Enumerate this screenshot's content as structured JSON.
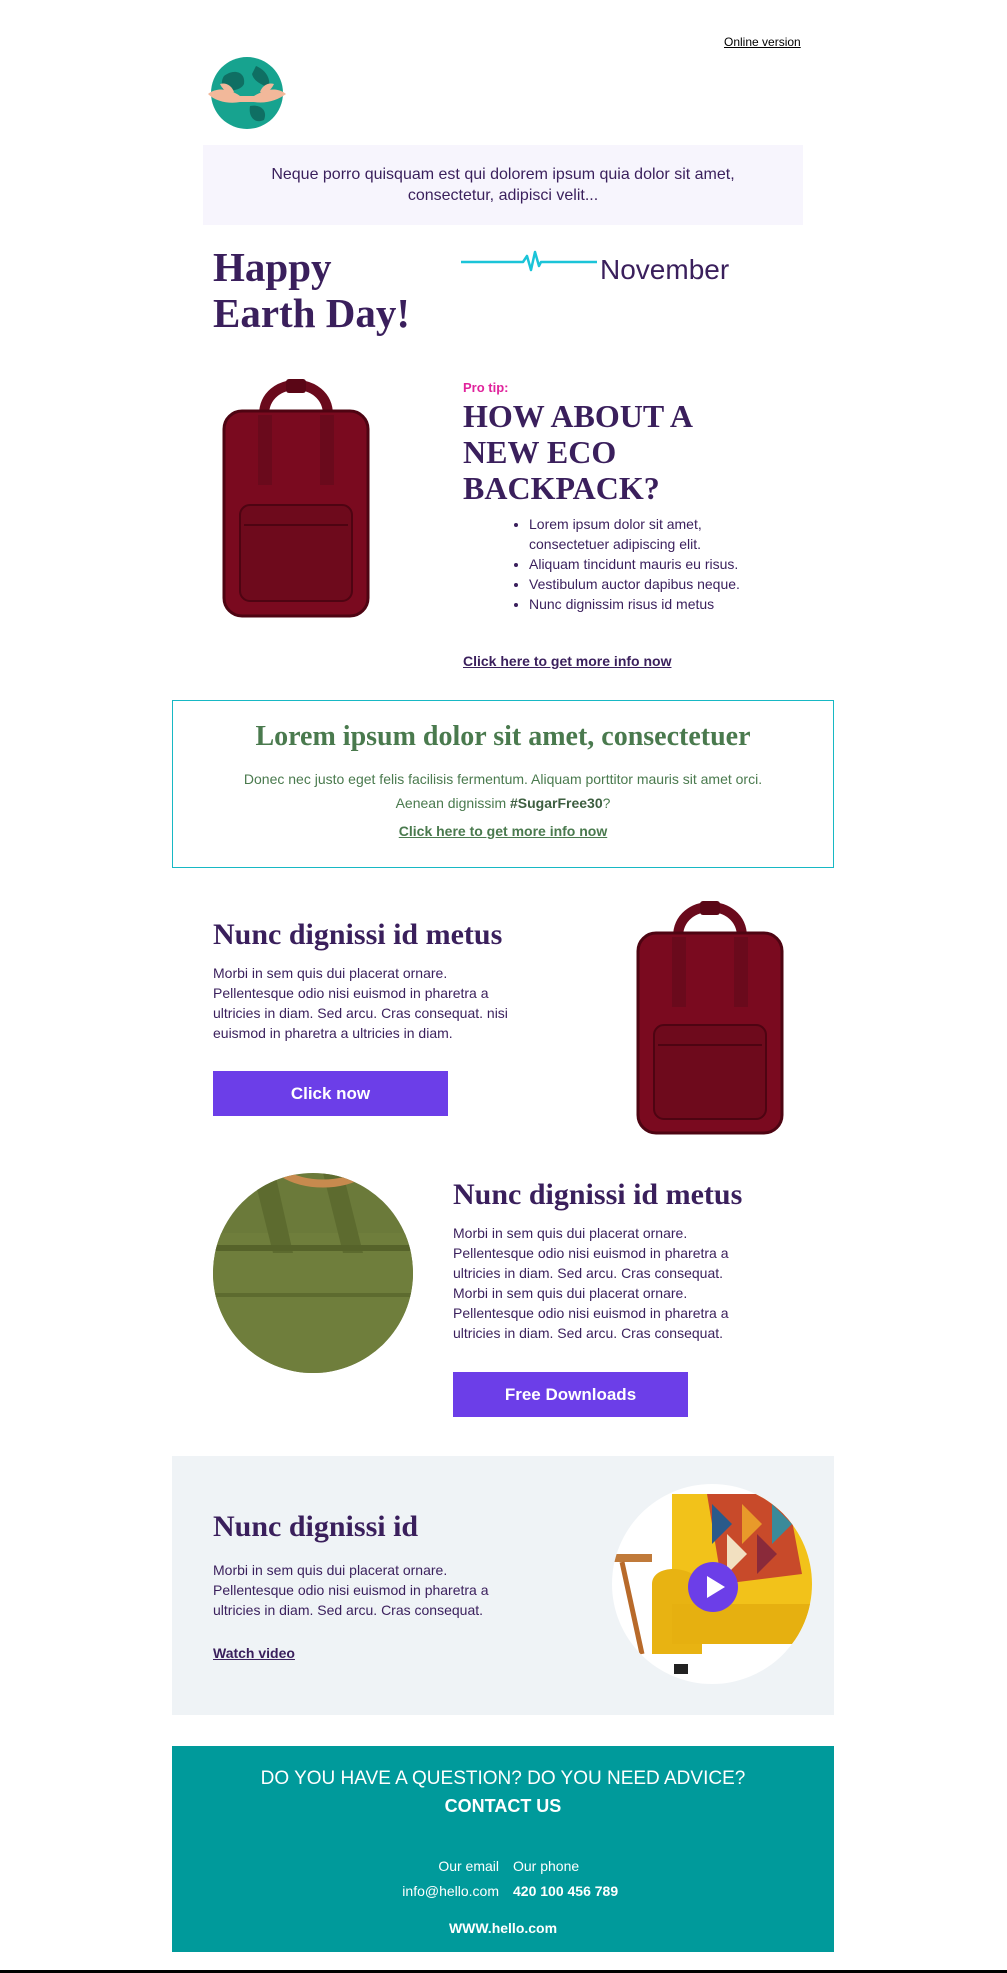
{
  "header": {
    "online_version": "Online version",
    "logo_icon": "earth-hug-icon"
  },
  "intro": {
    "text": "Neque porro quisquam est qui dolorem ipsum quia dolor sit amet, consectetur, adipisci velit..."
  },
  "hero": {
    "title_line1": "Happy",
    "title_line2": "Earth Day!",
    "month": "November",
    "pulse_icon": "heartbeat-line-icon"
  },
  "protip": {
    "label": "Pro tip:",
    "title": "HOW ABOUT A NEW ECO BACKPACK?",
    "bullets": [
      "Lorem ipsum dolor sit amet, consectetuer adipiscing elit.",
      "Aliquam tincidunt mauris eu risus.",
      "Vestibulum auctor dapibus neque.",
      "Nunc dignissim risus id metus"
    ],
    "link": "Click here to get more info now"
  },
  "boxed": {
    "title": "Lorem ipsum dolor sit amet, consectetuer",
    "text_part1": "Donec nec justo eget felis facilisis fermentum. Aliquam porttitor mauris sit amet orci. Aenean dignissim ",
    "hashtag": "#SugarFree30",
    "text_part2": "?",
    "link": "Click here to get more info now"
  },
  "section1": {
    "title": "Nunc dignissi id metus",
    "text": "Morbi in sem quis dui placerat ornare. Pellentesque odio nisi euismod in pharetra a ultricies in diam. Sed arcu. Cras consequat. nisi euismod in pharetra a ultricies in diam.",
    "button": "Click now"
  },
  "section2": {
    "title": "Nunc dignissi id metus",
    "text": "Morbi in sem quis dui placerat ornare. Pellentesque odio nisi euismod in pharetra a ultricies in diam. Sed arcu. Cras consequat. Morbi in sem quis dui placerat ornare. Pellentesque odio nisi euismod in pharetra a ultricies in diam. Sed arcu. Cras consequat.",
    "button": "Free Downloads"
  },
  "section3": {
    "title": "Nunc dignissi id",
    "text": "Morbi in sem quis dui placerat ornare. Pellentesque odio nisi euismod in pharetra a ultricies in diam. Sed arcu. Cras consequat.",
    "link": "Watch video",
    "play_icon": "play-icon"
  },
  "footer": {
    "question": "DO YOU HAVE A QUESTION? DO YOU NEED ADVICE?",
    "contact": "CONTACT US",
    "email_label": "Our email",
    "email_value": "info@hello.com",
    "phone_label": "Our phone",
    "phone_value": "420 100 456 789",
    "website": "WWW.hello.com"
  },
  "colors": {
    "primary_text": "#3a1f5c",
    "accent_pink": "#e0239c",
    "button_purple": "#6c3ee8",
    "teal": "#009a9b",
    "box_border": "#17b8c4",
    "green_text": "#4a7a4e",
    "backpack_red": "#7a0a1f"
  }
}
